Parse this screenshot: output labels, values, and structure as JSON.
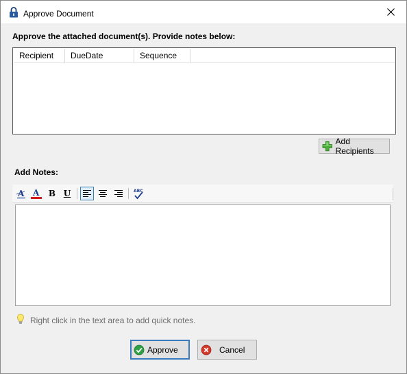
{
  "window": {
    "title": "Approve Document",
    "title_icon": "lock-icon",
    "close_icon": "close-icon"
  },
  "instructions": "Approve the attached document(s). Provide notes below:",
  "recipients_table": {
    "columns": [
      "Recipient",
      "DueDate",
      "Sequence"
    ],
    "rows": []
  },
  "add_recipients": {
    "label": "Add Recipients",
    "icon": "plus-icon",
    "icon_color": "#3a9d2a"
  },
  "notes": {
    "label": "Add Notes:",
    "value": "",
    "toolbar": [
      {
        "name": "font-style-icon",
        "glyph": "A"
      },
      {
        "name": "font-color-icon",
        "glyph": "A",
        "color": "#d61a1a"
      },
      {
        "name": "bold-icon",
        "glyph": "B"
      },
      {
        "name": "underline-icon",
        "glyph": "U"
      },
      {
        "name": "align-left-icon",
        "active": true
      },
      {
        "name": "align-center-icon"
      },
      {
        "name": "align-right-icon"
      },
      {
        "name": "spell-check-icon",
        "glyph": "ABC"
      }
    ]
  },
  "hint": {
    "icon": "lightbulb-icon",
    "text": "Right click in the text area to add quick notes."
  },
  "buttons": {
    "approve": {
      "label": "Approve",
      "icon": "check-icon",
      "color": "#2ea043"
    },
    "cancel": {
      "label": "Cancel",
      "icon": "cancel-icon",
      "color": "#d43a2a"
    }
  },
  "colors": {
    "accent": "#3a7bbf",
    "background": "#f0f0f0"
  }
}
